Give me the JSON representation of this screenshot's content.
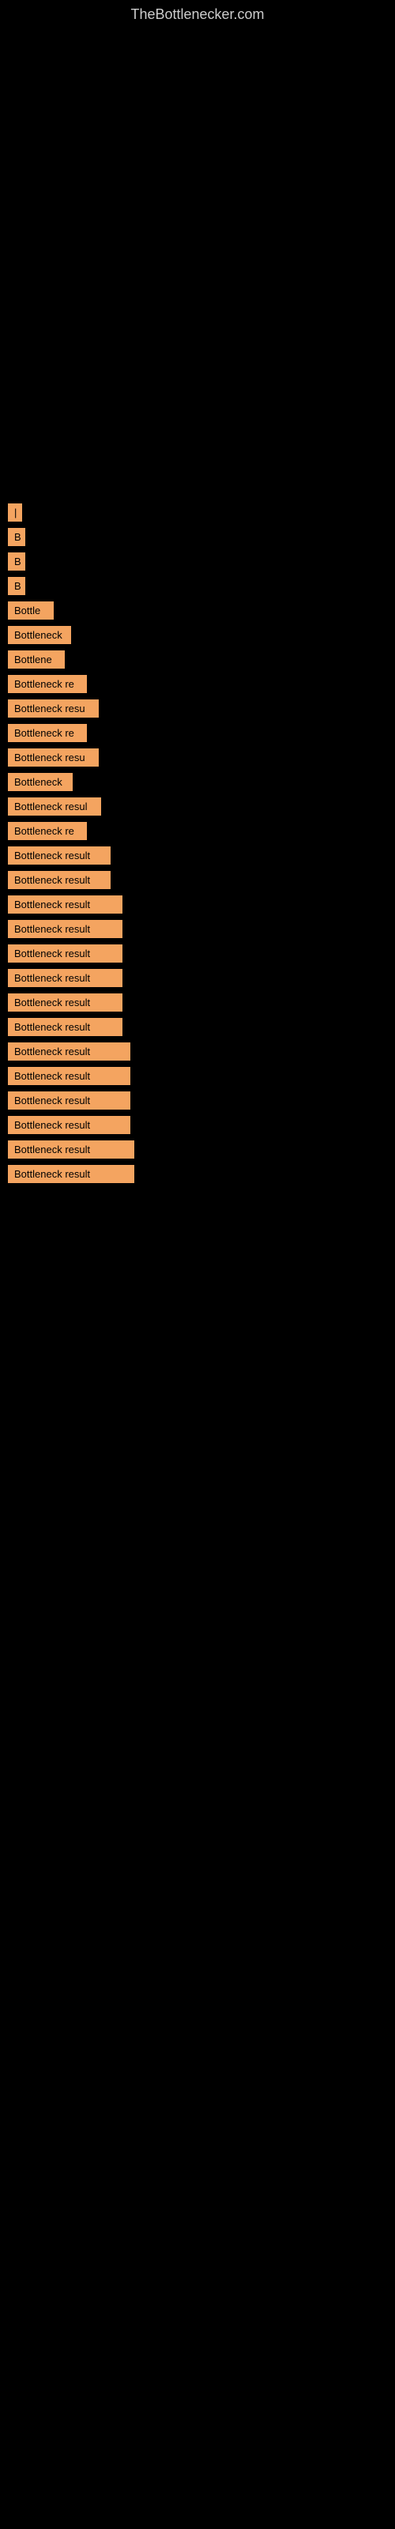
{
  "site": {
    "title": "TheBottlenecker.com"
  },
  "items": [
    {
      "id": 1,
      "label": "|",
      "class": "item-1"
    },
    {
      "id": 2,
      "label": "B",
      "class": "item-2"
    },
    {
      "id": 3,
      "label": "B",
      "class": "item-3"
    },
    {
      "id": 4,
      "label": "B",
      "class": "item-4"
    },
    {
      "id": 5,
      "label": "Bottle",
      "class": "item-5"
    },
    {
      "id": 6,
      "label": "Bottleneck",
      "class": "item-6"
    },
    {
      "id": 7,
      "label": "Bottlene",
      "class": "item-7"
    },
    {
      "id": 8,
      "label": "Bottleneck re",
      "class": "item-8"
    },
    {
      "id": 9,
      "label": "Bottleneck resu",
      "class": "item-9"
    },
    {
      "id": 10,
      "label": "Bottleneck re",
      "class": "item-10"
    },
    {
      "id": 11,
      "label": "Bottleneck resu",
      "class": "item-11"
    },
    {
      "id": 12,
      "label": "Bottleneck",
      "class": "item-12"
    },
    {
      "id": 13,
      "label": "Bottleneck resul",
      "class": "item-13"
    },
    {
      "id": 14,
      "label": "Bottleneck re",
      "class": "item-14"
    },
    {
      "id": 15,
      "label": "Bottleneck result",
      "class": "item-15"
    },
    {
      "id": 16,
      "label": "Bottleneck result",
      "class": "item-16"
    },
    {
      "id": 17,
      "label": "Bottleneck result",
      "class": "item-17"
    },
    {
      "id": 18,
      "label": "Bottleneck result",
      "class": "item-18"
    },
    {
      "id": 19,
      "label": "Bottleneck result",
      "class": "item-19"
    },
    {
      "id": 20,
      "label": "Bottleneck result",
      "class": "item-20"
    },
    {
      "id": 21,
      "label": "Bottleneck result",
      "class": "item-21"
    },
    {
      "id": 22,
      "label": "Bottleneck result",
      "class": "item-22"
    },
    {
      "id": 23,
      "label": "Bottleneck result",
      "class": "item-23"
    },
    {
      "id": 24,
      "label": "Bottleneck result",
      "class": "item-24"
    },
    {
      "id": 25,
      "label": "Bottleneck result",
      "class": "item-25"
    },
    {
      "id": 26,
      "label": "Bottleneck result",
      "class": "item-26"
    },
    {
      "id": 27,
      "label": "Bottleneck result",
      "class": "item-27"
    },
    {
      "id": 28,
      "label": "Bottleneck result",
      "class": "item-28"
    }
  ]
}
